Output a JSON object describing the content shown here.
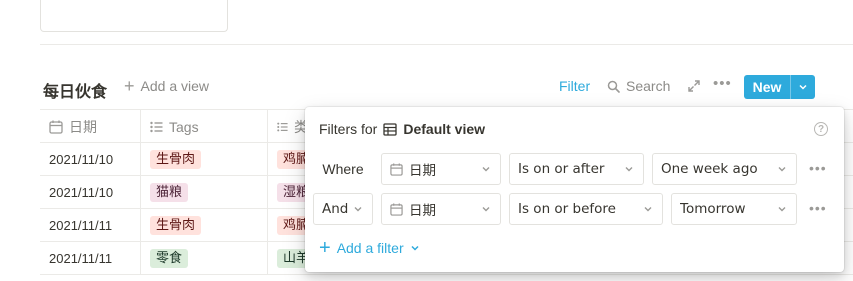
{
  "database": {
    "title": "每日伙食",
    "add_view_label": "Add a view"
  },
  "toolbar": {
    "filter_label": "Filter",
    "search_label": "Search",
    "new_label": "New"
  },
  "table": {
    "columns": [
      {
        "label": "日期",
        "icon": "calendar-icon"
      },
      {
        "label": "Tags",
        "icon": "list-icon"
      },
      {
        "label": "类",
        "icon": "list-icon"
      }
    ],
    "rows": [
      {
        "date": "2021/11/10",
        "tag": "生骨肉",
        "tag_bg": "#ffe2dd",
        "tag_fg": "#5d1715",
        "type": "鸡腩",
        "type_bg": "#ffe2dd",
        "type_fg": "#5d1715"
      },
      {
        "date": "2021/11/10",
        "tag": "猫粮",
        "tag_bg": "#f5e0e9",
        "tag_fg": "#4c2337",
        "type": "湿粮",
        "type_bg": "#f5e0e9",
        "type_fg": "#4c2337"
      },
      {
        "date": "2021/11/11",
        "tag": "生骨肉",
        "tag_bg": "#ffe2dd",
        "tag_fg": "#5d1715",
        "type": "鸡腩",
        "type_bg": "#ffe2dd",
        "type_fg": "#5d1715"
      },
      {
        "date": "2021/11/11",
        "tag": "零食",
        "tag_bg": "#dbeddb",
        "tag_fg": "#1c3829",
        "type": "山羊",
        "type_bg": "#dbeddb",
        "type_fg": "#1c3829"
      }
    ]
  },
  "filter_popover": {
    "title_prefix": "Filters for",
    "view_name": "Default view",
    "rows": [
      {
        "connector": "Where",
        "property": "日期",
        "condition": "Is on or after",
        "value": "One week ago"
      },
      {
        "connector": "And",
        "property": "日期",
        "condition": "Is on or before",
        "value": "Tomorrow"
      }
    ],
    "add_filter_label": "Add a filter",
    "help_glyph": "?"
  },
  "colors": {
    "accent": "#2eaadc",
    "text": "#37352f",
    "muted": "#8c8b88"
  }
}
